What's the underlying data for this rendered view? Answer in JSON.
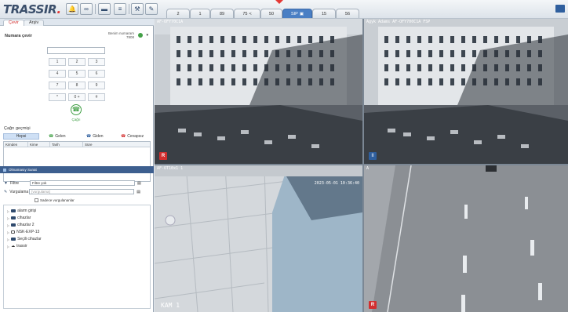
{
  "app": {
    "logo": "TRASSIR",
    "logo_dot": "."
  },
  "toolbar": {
    "icons": [
      "bell-icon",
      "voicemail-icon",
      "screen-icon",
      "list-icon",
      "wrench-icon",
      "edit-icon"
    ]
  },
  "layout_tabs": [
    {
      "label": "2",
      "active": false
    },
    {
      "label": "1",
      "active": false
    },
    {
      "label": "89",
      "active": false
    },
    {
      "label": "75",
      "active": false,
      "icon": "share-icon"
    },
    {
      "label": "50",
      "active": false
    },
    {
      "label": "SIP",
      "active": true,
      "icon": "save-icon"
    },
    {
      "label": "15",
      "active": false
    },
    {
      "label": "56",
      "active": false
    }
  ],
  "sip": {
    "tabs": [
      {
        "label": "Çevir",
        "active": true
      },
      {
        "label": "Arşiv",
        "active": false
      }
    ],
    "dial_title": "Numara çevir",
    "my_number_label": "Benim numaram",
    "my_number": "7808",
    "dial_value": "",
    "keys": [
      "1",
      "2",
      "3",
      "4",
      "5",
      "6",
      "7",
      "8",
      "9",
      "*",
      "0 +",
      "#"
    ],
    "call_label": "Çağrı",
    "history_title": "Çağrı geçmişi",
    "history_filters": [
      {
        "label": "Hepsi",
        "active": true
      },
      {
        "label": "Gelen",
        "active": false,
        "icon": "incoming-call-icon"
      },
      {
        "label": "Giden",
        "active": false,
        "icon": "outgoing-call-icon"
      },
      {
        "label": "Cevapsız",
        "active": false,
        "icon": "missed-call-icon"
      }
    ],
    "history_columns": [
      "Kimden",
      "Kime",
      "Tarih",
      "Süre"
    ]
  },
  "object_tree": {
    "header": "Olmamasıy Sunat",
    "filter_label": "Filtre",
    "filter_value": "Filtre yok",
    "groups_label": "Vurgulama",
    "groups_placeholder": "[vurgulama]",
    "only_groups_label": "Sadece vurgulananlar",
    "items": [
      "alarm girişi",
      "cihazlar",
      "cihazlar 2",
      "NSK-EXP-13",
      "Seçili cihazlar",
      "trassir"
    ]
  },
  "cameras": [
    {
      "title": "AF-OFY70C1A",
      "badge": "R"
    },
    {
      "title": "Agyk Adams AF-OFY700C1A FSP",
      "badge": "II"
    },
    {
      "title": "AF-OT10x1 1",
      "timestamp": "2023-05-01 10:36:40",
      "cam_label": "KAM 1"
    },
    {
      "title": "A",
      "badge": "R"
    }
  ]
}
